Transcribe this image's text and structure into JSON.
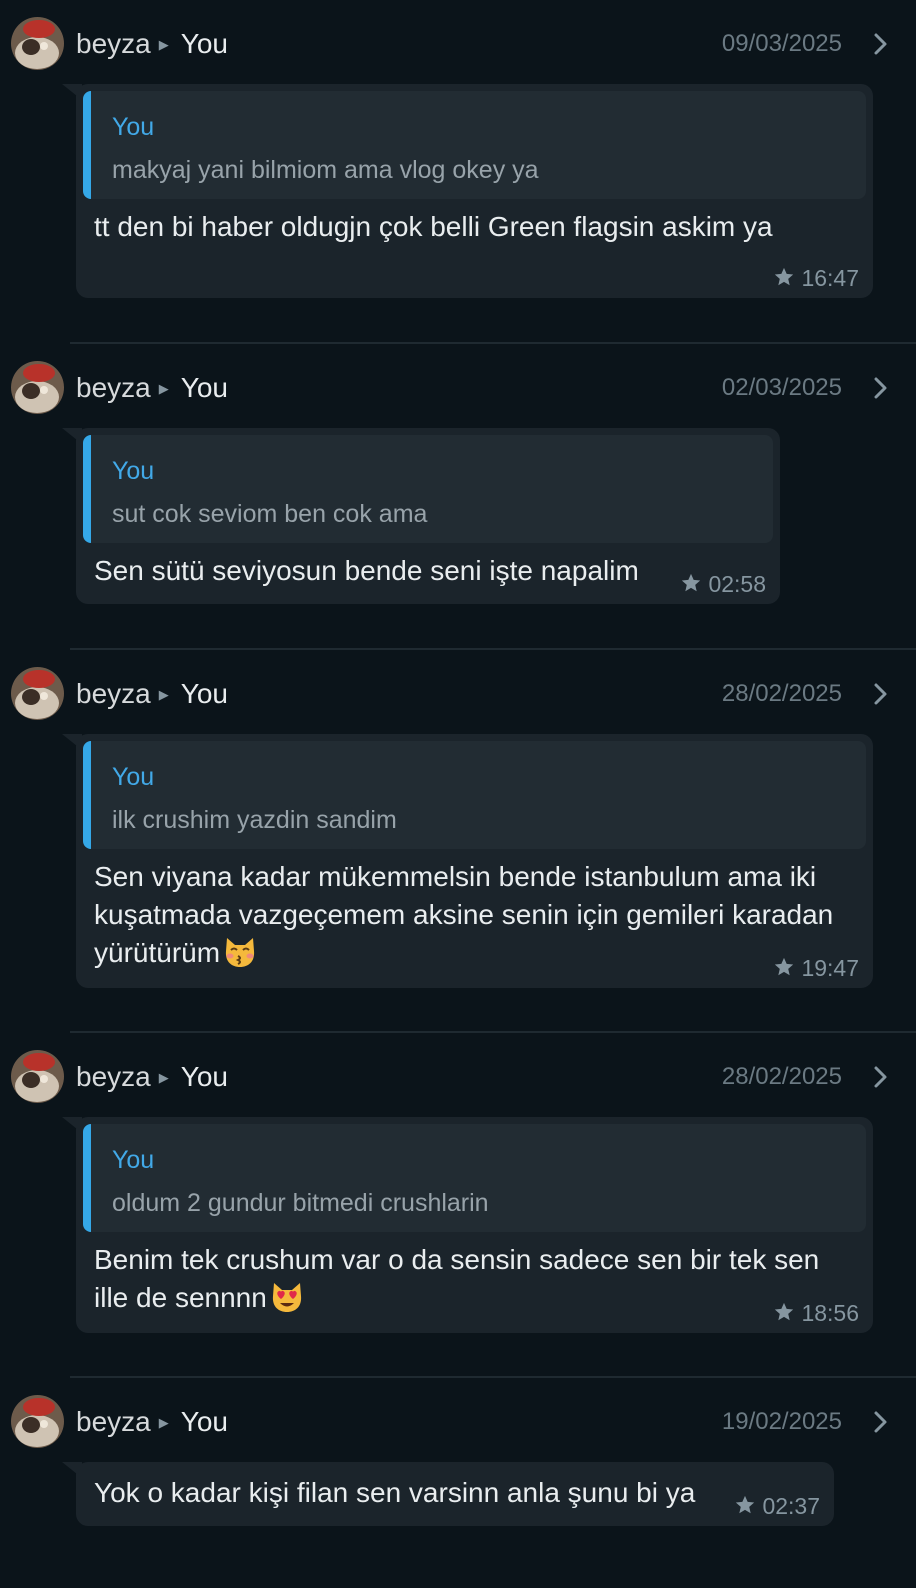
{
  "messages": [
    {
      "sender": "beyza",
      "recipient": "You",
      "date": "09/03/2025",
      "quote": {
        "author": "You",
        "text": "makyaj yani bilmiom ama vlog okey ya"
      },
      "text": "tt den bi haber oldugjn çok belli Green flagsin askim ya",
      "time": "16:47",
      "starred": true
    },
    {
      "sender": "beyza",
      "recipient": "You",
      "date": "02/03/2025",
      "quote": {
        "author": "You",
        "text": "sut cok seviom ben cok ama"
      },
      "text": "Sen sütü seviyosun bende seni işte napalim",
      "time": "02:58",
      "starred": true
    },
    {
      "sender": "beyza",
      "recipient": "You",
      "date": "28/02/2025",
      "quote": {
        "author": "You",
        "text": "ilk crushim yazdin sandim"
      },
      "text": "Sen viyana kadar mükemmelsin bende istanbulum ama iki kuşatmada vazgeçemem aksine senin için  gemileri karadan yürütürüm",
      "emoji": "kissing-cat-emoji-icon",
      "time": "19:47",
      "starred": true
    },
    {
      "sender": "beyza",
      "recipient": "You",
      "date": "28/02/2025",
      "quote": {
        "author": "You",
        "text": "oldum 2 gundur bitmedi crushlarin"
      },
      "text": "Benim tek crushum var o da sensin sadece sen bir tek sen ille de sennnn",
      "emoji": "heart-eyes-cat-emoji-icon",
      "time": "18:56",
      "starred": true
    },
    {
      "sender": "beyza",
      "recipient": "You",
      "date": "19/02/2025",
      "text": "Yok o kadar kişi filan sen varsinn anla şunu bi ya",
      "time": "02:37",
      "starred": true
    }
  ],
  "colors": {
    "background": "#0b141a",
    "bubble": "#1b242b",
    "quote_bar": "#35a8e8",
    "quote_author": "#42a9e8"
  }
}
